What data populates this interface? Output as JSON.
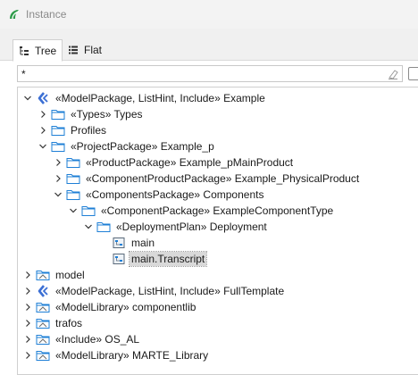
{
  "window": {
    "title": "Instance"
  },
  "tabs": [
    {
      "label": "Tree",
      "icon": "tree-view-icon",
      "active": true
    },
    {
      "label": "Flat",
      "icon": "flat-list-icon",
      "active": false
    }
  ],
  "filter": {
    "value": "*"
  },
  "tree": [
    {
      "label": "«ModelPackage, ListHint, Include» Example",
      "icon": "model-package-icon",
      "state": "expanded"
    },
    {
      "label": "«Types» Types",
      "icon": "folder-icon",
      "state": "collapsed"
    },
    {
      "label": "Profiles",
      "icon": "folder-icon",
      "state": "collapsed"
    },
    {
      "label": "«ProjectPackage» Example_p",
      "icon": "folder-icon",
      "state": "expanded"
    },
    {
      "label": "«ProductPackage» Example_pMainProduct",
      "icon": "folder-icon",
      "state": "collapsed"
    },
    {
      "label": "«ComponentProductPackage» Example_PhysicalProduct",
      "icon": "folder-icon",
      "state": "collapsed"
    },
    {
      "label": "«ComponentsPackage» Components",
      "icon": "folder-icon",
      "state": "expanded"
    },
    {
      "label": "«ComponentPackage» ExampleComponentType",
      "icon": "folder-icon",
      "state": "expanded"
    },
    {
      "label": "«DeploymentPlan» Deployment",
      "icon": "folder-icon",
      "state": "expanded"
    },
    {
      "label": "main",
      "icon": "diagram-icon",
      "state": "leaf"
    },
    {
      "label": "main.Transcript",
      "icon": "diagram-icon",
      "state": "leaf",
      "selected": true
    },
    {
      "label": "model",
      "icon": "library-folder-icon",
      "state": "collapsed"
    },
    {
      "label": "«ModelPackage, ListHint, Include» FullTemplate",
      "icon": "model-package-icon",
      "state": "collapsed"
    },
    {
      "label": "«ModelLibrary» componentlib",
      "icon": "library-folder-icon",
      "state": "collapsed"
    },
    {
      "label": "trafos",
      "icon": "library-folder-icon",
      "state": "collapsed"
    },
    {
      "label": "«Include» OS_AL",
      "icon": "library-folder-icon",
      "state": "collapsed"
    },
    {
      "label": "«ModelLibrary» MARTE_Library",
      "icon": "library-folder-icon",
      "state": "collapsed"
    }
  ],
  "colors": {
    "folder_stroke": "#1e7fd6",
    "model_package": "#3b6fd4",
    "selection": "#d9d9d9"
  }
}
